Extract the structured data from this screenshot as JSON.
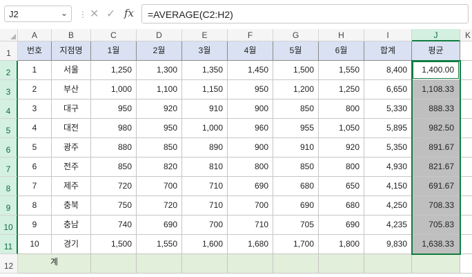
{
  "name_box": "J2",
  "formula": "=AVERAGE(C2:H2)",
  "icons": {
    "cancel": "x-icon",
    "enter": "check-icon",
    "function": "fx-icon"
  },
  "fx_label": "fx",
  "columns": [
    "A",
    "B",
    "C",
    "D",
    "E",
    "F",
    "G",
    "H",
    "I",
    "J",
    "K"
  ],
  "rows": [
    "1",
    "2",
    "3",
    "4",
    "5",
    "6",
    "7",
    "8",
    "9",
    "10",
    "11",
    "12"
  ],
  "headers": [
    "번호",
    "지점명",
    "1월",
    "2월",
    "3월",
    "4월",
    "5월",
    "6월",
    "합계",
    "평균"
  ],
  "data": [
    [
      "1",
      "서울",
      "1,250",
      "1,300",
      "1,350",
      "1,450",
      "1,500",
      "1,550",
      "8,400",
      "1,400.00"
    ],
    [
      "2",
      "부산",
      "1,000",
      "1,100",
      "1,150",
      "950",
      "1,200",
      "1,250",
      "6,650",
      "1,108.33"
    ],
    [
      "3",
      "대구",
      "950",
      "920",
      "910",
      "900",
      "850",
      "800",
      "5,330",
      "888.33"
    ],
    [
      "4",
      "대전",
      "980",
      "950",
      "1,000",
      "960",
      "955",
      "1,050",
      "5,895",
      "982.50"
    ],
    [
      "5",
      "광주",
      "880",
      "850",
      "890",
      "900",
      "910",
      "920",
      "5,350",
      "891.67"
    ],
    [
      "6",
      "전주",
      "850",
      "820",
      "810",
      "800",
      "850",
      "800",
      "4,930",
      "821.67"
    ],
    [
      "7",
      "제주",
      "720",
      "700",
      "710",
      "690",
      "680",
      "650",
      "4,150",
      "691.67"
    ],
    [
      "8",
      "충북",
      "750",
      "720",
      "710",
      "700",
      "690",
      "680",
      "4,250",
      "708.33"
    ],
    [
      "9",
      "충남",
      "740",
      "690",
      "700",
      "710",
      "705",
      "690",
      "4,235",
      "705.83"
    ],
    [
      "10",
      "경기",
      "1,500",
      "1,550",
      "1,600",
      "1,680",
      "1,700",
      "1,800",
      "9,830",
      "1,638.33"
    ]
  ],
  "total_label": "계",
  "colors": {
    "header_fill": "#d9e1f2",
    "average_fill": "#bfbfbf",
    "total_fill": "#e2efda",
    "selection": "#107c41"
  }
}
